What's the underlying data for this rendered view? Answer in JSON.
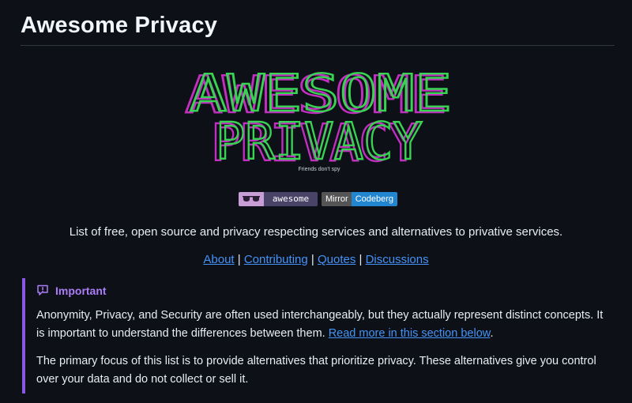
{
  "header": {
    "title": "Awesome Privacy"
  },
  "logo": {
    "line1": "AWESOME",
    "line2": "PRIVACY",
    "tagline": "Friends don't spy",
    "colors": {
      "green": "#39d353",
      "magenta": "#c02fc0"
    }
  },
  "badges": {
    "awesome": {
      "icon": "sunglasses-icon",
      "label": "awesome"
    },
    "mirror": {
      "left": "Mirror",
      "right": "Codeberg"
    }
  },
  "description": "List of free, open source and privacy respecting services and alternatives to privative services.",
  "nav_links": {
    "about": "About",
    "contributing": "Contributing",
    "quotes": "Quotes",
    "discussions": "Discussions",
    "separator": "|"
  },
  "callout": {
    "icon": "speech-bubble-icon",
    "title": "Important",
    "p1_text": "Anonymity, Privacy, and Security are often used interchangeably, but they actually represent distinct concepts. It is important to understand the differences between them.",
    "p1_link": "Read more in this section below",
    "p1_end": ".",
    "p2_text": "The primary focus of this list is to provide alternatives that prioritize privacy. These alternatives give you control over your data and do not collect or sell it.",
    "accent": "#8957e5"
  }
}
